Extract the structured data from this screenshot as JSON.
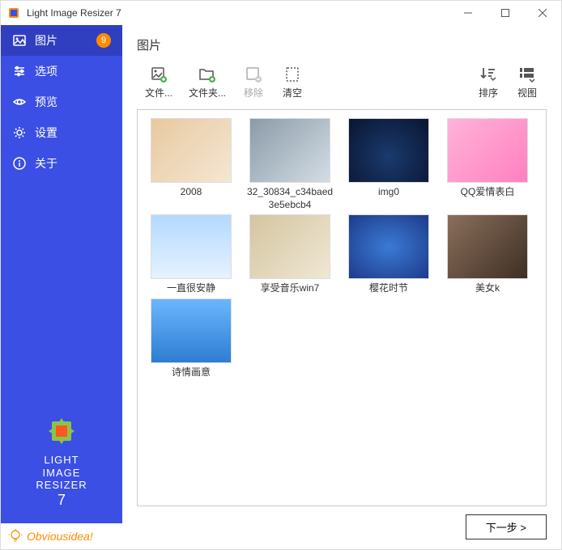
{
  "app": {
    "title": "Light Image Resizer 7"
  },
  "sidebar": {
    "items": [
      {
        "label": "图片",
        "icon": "image",
        "active": true,
        "badge": "9"
      },
      {
        "label": "选项",
        "icon": "sliders"
      },
      {
        "label": "预览",
        "icon": "eye"
      },
      {
        "label": "设置",
        "icon": "gear"
      },
      {
        "label": "关于",
        "icon": "info"
      }
    ],
    "logo": {
      "line1": "LIGHT",
      "line2": "IMAGE",
      "line3": "RESIZER",
      "version": "7"
    },
    "footer": "Obviousidea!"
  },
  "page": {
    "title": "图片"
  },
  "toolbar": {
    "left": [
      {
        "label": "文件...",
        "icon": "file-add",
        "disabled": false
      },
      {
        "label": "文件夹...",
        "icon": "folder-add",
        "disabled": false
      },
      {
        "label": "移除",
        "icon": "remove",
        "disabled": true
      },
      {
        "label": "清空",
        "icon": "clear",
        "disabled": false
      }
    ],
    "right": [
      {
        "label": "排序",
        "icon": "sort"
      },
      {
        "label": "视图",
        "icon": "view"
      }
    ]
  },
  "images": [
    {
      "name": "2008",
      "style": "g1"
    },
    {
      "name": "32_30834_c34baed3e5ebcb4",
      "style": "g2"
    },
    {
      "name": "img0",
      "style": "g3"
    },
    {
      "name": "QQ爱情表白",
      "style": "g4"
    },
    {
      "name": "一直很安静",
      "style": "g5"
    },
    {
      "name": "享受音乐win7",
      "style": "g6"
    },
    {
      "name": "樱花时节",
      "style": "g7"
    },
    {
      "name": "美女k",
      "style": "g8"
    },
    {
      "name": "诗情画意",
      "style": "g9"
    }
  ],
  "footer": {
    "next": "下一步 >"
  }
}
